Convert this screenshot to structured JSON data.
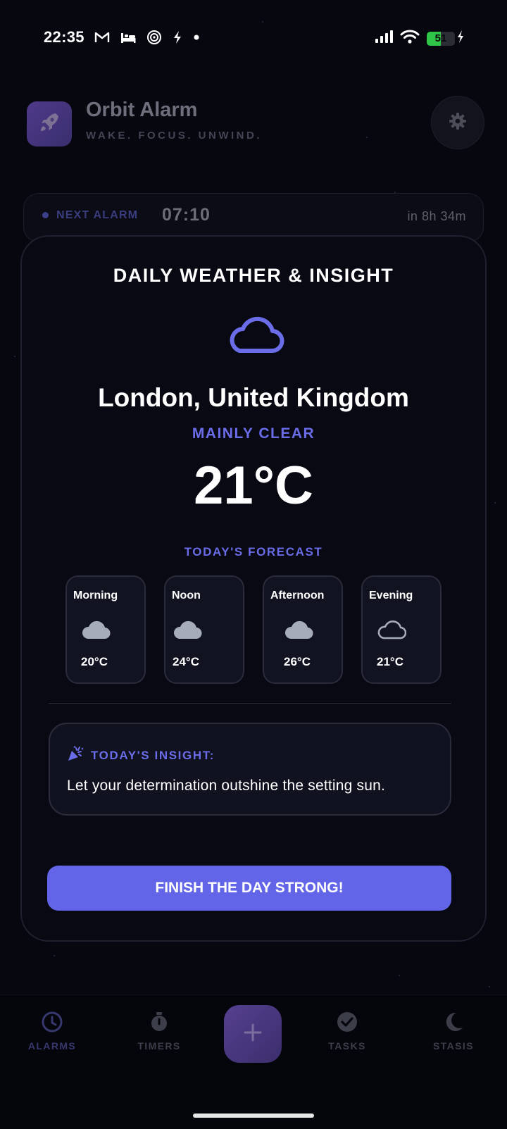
{
  "status_bar": {
    "time": "22:35",
    "battery_level": "51",
    "battery_fraction": 0.51,
    "left_icons": [
      "gmail-icon",
      "bed-icon",
      "spiral-icon",
      "bolt-icon",
      "dot-icon"
    ],
    "right_icons": [
      "signal-icon",
      "wifi-icon",
      "battery-icon",
      "charging-icon"
    ]
  },
  "app": {
    "title": "Orbit Alarm",
    "tagline": "WAKE. FOCUS. UNWIND.",
    "logo_icon": "rocket-icon",
    "settings_icon": "gear-icon"
  },
  "next_alarm": {
    "label": "NEXT ALARM",
    "time": "07:10",
    "eta": "in 8h 34m"
  },
  "weather_card": {
    "title": "DAILY WEATHER & INSIGHT",
    "icon": "cloud-icon",
    "location": "London, United Kingdom",
    "condition": "MAINLY CLEAR",
    "temperature": "21°C",
    "forecast_label": "TODAY'S FORECAST",
    "forecast": [
      {
        "period": "Morning",
        "temp": "20°C",
        "icon": "cloud-filled-icon"
      },
      {
        "period": "Noon",
        "temp": "24°C",
        "icon": "cloud-filled-icon"
      },
      {
        "period": "Afternoon",
        "temp": "26°C",
        "icon": "cloud-filled-icon"
      },
      {
        "period": "Evening",
        "temp": "21°C",
        "icon": "cloud-outline-icon"
      }
    ],
    "insight_title": "TODAY'S INSIGHT:",
    "insight_icon": "party-popper-icon",
    "insight_text": "Let your determination outshine the setting sun.",
    "cta_label": "FINISH THE DAY STRONG!"
  },
  "bottom_nav": {
    "items": [
      {
        "label": "ALARMS",
        "icon": "clock-icon"
      },
      {
        "label": "TIMERS",
        "icon": "stopwatch-icon"
      },
      {
        "label": "TASKS",
        "icon": "check-circle-icon"
      },
      {
        "label": "STASIS",
        "icon": "moon-icon"
      }
    ],
    "add_icon": "plus-icon"
  },
  "colors": {
    "accent": "#6265e7",
    "accent_text": "#6a6ce8",
    "background": "#06070f",
    "battery_green": "#2fc548"
  }
}
